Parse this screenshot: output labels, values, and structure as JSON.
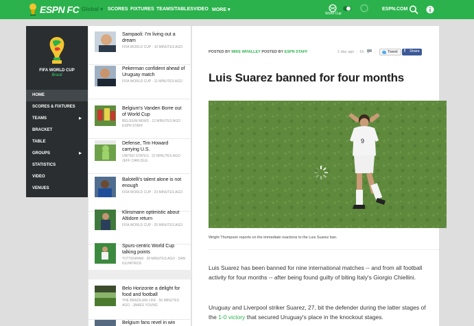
{
  "topnav": {
    "logo": "ESPN FC",
    "global_label": "Global",
    "items": [
      "SCORES",
      "FIXTURES",
      "TEAMS/TABLES",
      "VIDEO",
      "MORE"
    ],
    "world_cup_label": "World Cup",
    "espn_com": "ESPN.COM"
  },
  "leftnav": {
    "title": "FIFA WORLD CUP",
    "subtitle": "Brasil",
    "items": [
      {
        "label": "HOME",
        "has_caret": false,
        "active": true
      },
      {
        "label": "SCORES & FIXTURES",
        "has_caret": false
      },
      {
        "label": "TEAMS",
        "has_caret": true
      },
      {
        "label": "BRACKET",
        "has_caret": false
      },
      {
        "label": "TABLE",
        "has_caret": false
      },
      {
        "label": "GROUPS",
        "has_caret": true
      },
      {
        "label": "STATISTICS",
        "has_caret": false
      },
      {
        "label": "VIDEO",
        "has_caret": false
      },
      {
        "label": "VENUES",
        "has_caret": false
      }
    ]
  },
  "feed": [
    {
      "title": "Sampaoli: I'm living out a dream",
      "meta": "FIFA WORLD CUP · 10 minutes ago"
    },
    {
      "title": "Pekerman confident ahead of Uruguay match",
      "meta": "FIFA WORLD CUP · 11 minutes ago"
    },
    {
      "title": "Belgium's Vanden Borre out of World Cup",
      "meta": "BELGIUM NEWS · 12 minutes ago · ESPN STAFF"
    },
    {
      "title": "Defense, Tim Howard carrying U.S.",
      "meta": "UNITED STATES · 22 minutes ago · JEFF CARLISLE"
    },
    {
      "title": "Balotelli's talent alone is not enough",
      "meta": "FIFA WORLD CUP · 23 minutes ago"
    },
    {
      "title": "Klinsmann optimistic about Altidore return",
      "meta": "FIFA WORLD CUP · 25 minutes ago"
    },
    {
      "title": "Spurs-centric World Cup talking points",
      "meta": "TOTTENHAM · 28 minutes ago · DAN KILPATRICK"
    },
    {
      "title": "Belo Horizonte a delight for food and football",
      "meta": "THE BRAZILIAN LIFE · 50 minutes ago · JAMES YOUNG"
    },
    {
      "title": "Belgium fans revel in win",
      "meta": ""
    }
  ],
  "article": {
    "posted_by_label": "POSTED BY",
    "author": "MIKE WHALLEY",
    "posted_by_label2": "POSTED BY",
    "staff": "ESPN STAFF",
    "time_ago": "1 day ago",
    "comments": "1K",
    "tweet_label": "Tweet",
    "share_label": "Share",
    "headline": "Luis Suarez banned for four months",
    "player_number": "9",
    "caption": "Wright Thompson reports on the immediate reactions to the Luis Suarez ban.",
    "para1": "Luis Suarez has been banned for nine international matches -- and from all football activity for four months -- after being found guilty of biting Italy's Giorgio Chiellini.",
    "para2_before": "Uruguay and Liverpool striker Suarez, 27, bit the defender during the latter stages of the ",
    "para2_link": "1-0 victory",
    "para2_after": " that secured Uruguay's place in the knockout stages."
  },
  "colors": {
    "brand_green": "#2bb24c",
    "nav_dark": "#2a2e30",
    "facebook": "#3b5998",
    "twitter": "#55acee"
  }
}
